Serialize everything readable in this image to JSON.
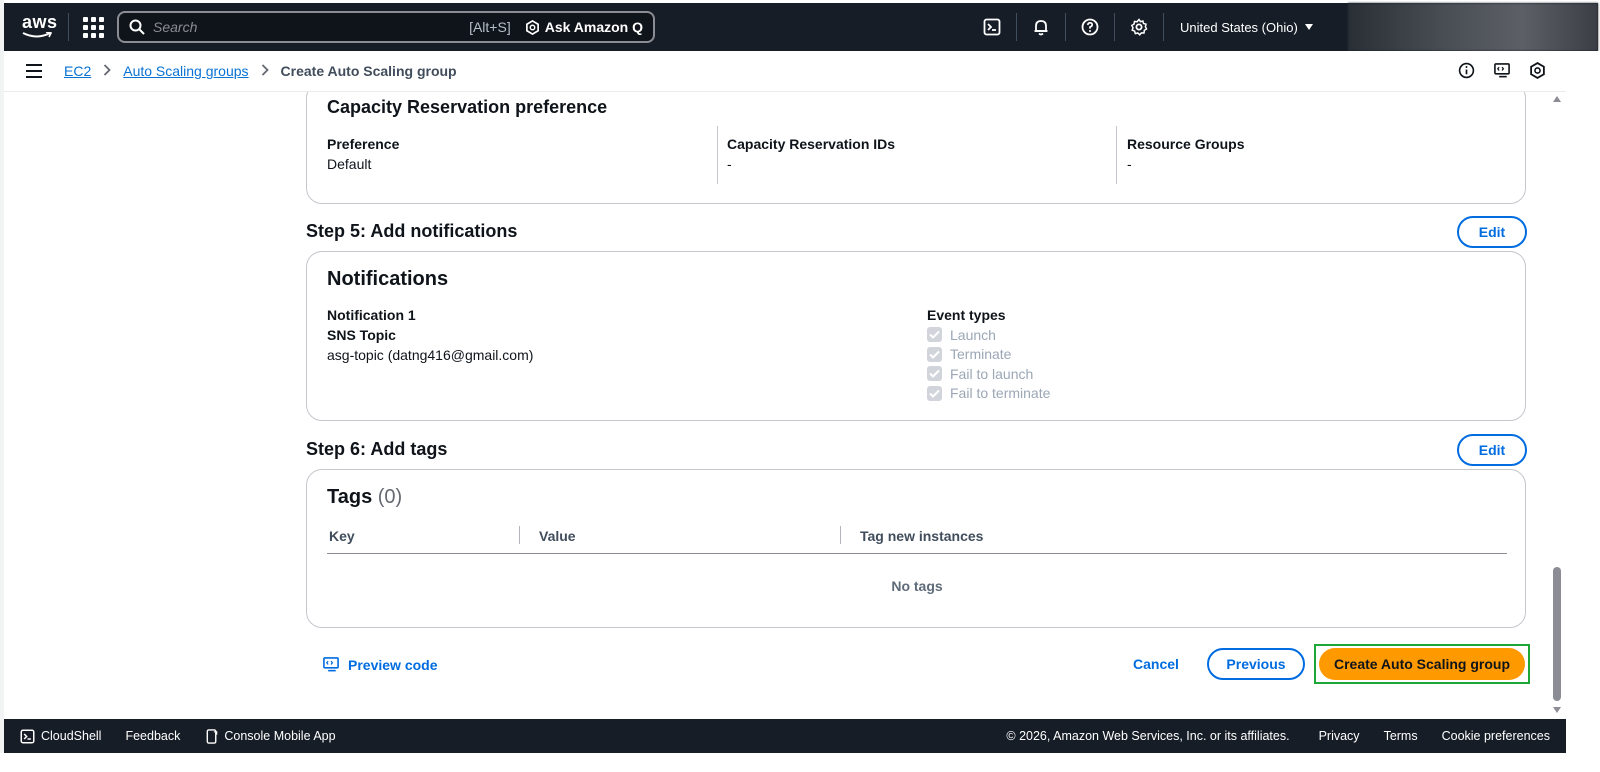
{
  "topnav": {
    "logo_text": "aws",
    "search_placeholder": "Search",
    "search_shortcut": "[Alt+S]",
    "ask_q_label": "Ask Amazon Q",
    "region": "United States (Ohio)"
  },
  "breadcrumb": {
    "items": [
      "EC2",
      "Auto Scaling groups"
    ],
    "current": "Create Auto Scaling group"
  },
  "capacity": {
    "title": "Capacity Reservation preference",
    "columns": [
      {
        "label": "Preference",
        "value": "Default"
      },
      {
        "label": "Capacity Reservation IDs",
        "value": "-"
      },
      {
        "label": "Resource Groups",
        "value": "-"
      }
    ]
  },
  "step5": {
    "heading": "Step 5: Add notifications",
    "edit_label": "Edit",
    "container_title": "Notifications",
    "notification_name": "Notification 1",
    "sns_label": "SNS Topic",
    "sns_value": "asg-topic (datng416@gmail.com)",
    "event_types_label": "Event types",
    "event_types": [
      "Launch",
      "Terminate",
      "Fail to launch",
      "Fail to terminate"
    ]
  },
  "step6": {
    "heading": "Step 6: Add tags",
    "edit_label": "Edit",
    "container_title": "Tags",
    "count": "(0)",
    "columns": [
      "Key",
      "Value",
      "Tag new instances"
    ],
    "empty_text": "No tags"
  },
  "actions": {
    "preview_label": "Preview code",
    "cancel_label": "Cancel",
    "previous_label": "Previous",
    "create_label": "Create Auto Scaling group"
  },
  "footer": {
    "cloudshell": "CloudShell",
    "feedback": "Feedback",
    "mobile_app": "Console Mobile App",
    "copyright": "© 2026, Amazon Web Services, Inc. or its affiliates.",
    "privacy": "Privacy",
    "terms": "Terms",
    "cookie": "Cookie preferences"
  },
  "colors": {
    "nav_bg": "#161d26",
    "link": "#006ce0",
    "primary": "#ff9900",
    "highlight": "#1da636"
  }
}
